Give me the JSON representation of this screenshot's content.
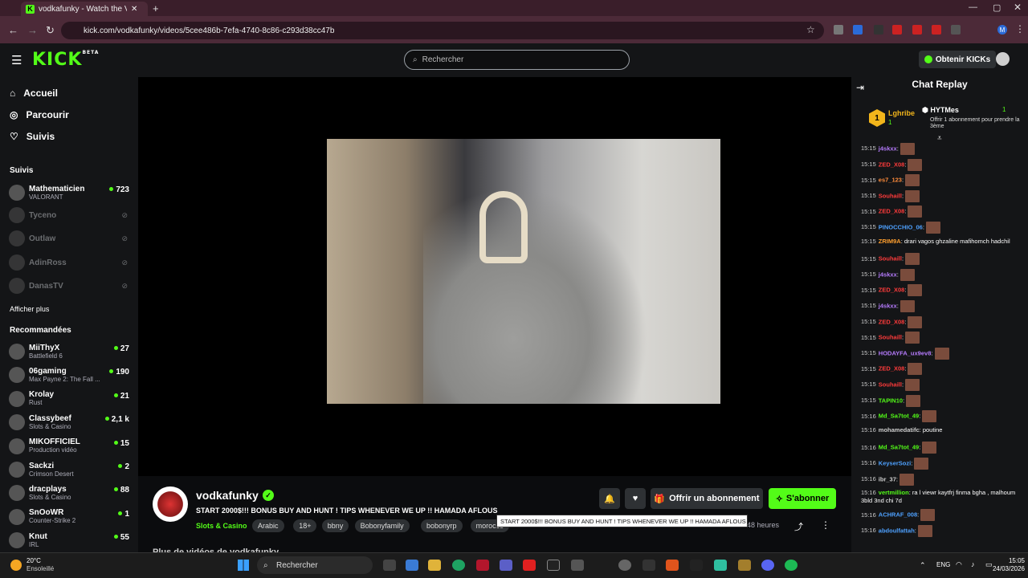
{
  "browser": {
    "tab_title": "vodkafunky - Watch the VO",
    "url": "kick.com/vodkafunky/videos/5cee486b-7efa-4740-8c86-c293d38cc47b"
  },
  "header": {
    "logo": "KICK",
    "logo_badge": "BETA",
    "search_placeholder": "Rechercher",
    "kicks_button": "Obtenir KICKs"
  },
  "sidebar": {
    "nav": [
      {
        "label": "Accueil",
        "icon": "home-icon"
      },
      {
        "label": "Parcourir",
        "icon": "compass-icon"
      },
      {
        "label": "Suivis",
        "icon": "heart-icon"
      }
    ],
    "followed_title": "Suivis",
    "followed": [
      {
        "name": "Mathematicien",
        "sub": "VALORANT",
        "count": "723",
        "live": true
      },
      {
        "name": "Tyceno",
        "sub": "",
        "count": "",
        "live": false
      },
      {
        "name": "Outlaw",
        "sub": "",
        "count": "",
        "live": false
      },
      {
        "name": "AdinRoss",
        "sub": "",
        "count": "",
        "live": false
      },
      {
        "name": "DanasTV",
        "sub": "",
        "count": "",
        "live": false
      }
    ],
    "show_more": "Afficher plus",
    "recommended_title": "Recommandées",
    "recommended": [
      {
        "name": "MiiThyX",
        "sub": "Battlefield 6",
        "count": "27"
      },
      {
        "name": "06gaming",
        "sub": "Max Payne 2: The Fall ...",
        "count": "190"
      },
      {
        "name": "Krolay",
        "sub": "Rust",
        "count": "21"
      },
      {
        "name": "Classybeef",
        "sub": "Slots & Casino",
        "count": "2,1 k"
      },
      {
        "name": "MIKOFFICIEL",
        "sub": "Production vidéo",
        "count": "15"
      },
      {
        "name": "Sackzi",
        "sub": "Crimson Desert",
        "count": "2"
      },
      {
        "name": "dracplays",
        "sub": "Slots & Casino",
        "count": "88"
      },
      {
        "name": "SnOoWR",
        "sub": "Counter-Strike 2",
        "count": "1"
      },
      {
        "name": "Knut",
        "sub": "IRL",
        "count": "55"
      }
    ]
  },
  "video": {
    "channel": "vodkafunky",
    "title": "START 2000$!!! BONUS BUY AND HUNT ! TIPS WHENEVER WE UP !! HAMADA AFLOUS",
    "category": "Slots & Casino",
    "tags": [
      "Arabic",
      "18+",
      "bbny",
      "Bobonyfamily",
      "bobonyrp",
      "morocco"
    ],
    "tooltip": "START 2000$!!! BONUS BUY AND HUNT ! TIPS WHENEVER WE UP !! HAMADA AFLOUS",
    "age": "48 heures",
    "gift_button": "Offrir un abonnement",
    "subscribe_button": "S'abonner",
    "more_videos": "Plus de vidéos de vodkafunky"
  },
  "chat": {
    "title": "Chat Replay",
    "gifter_rank": "1",
    "gifter_name": "Lghribe",
    "gifter_count": "1",
    "recipient_name": "HYTMes",
    "recipient_count": "1",
    "gift_text": "Offrir 1 abonnement pour prendre la 3ème",
    "messages": [
      {
        "t": "15:15",
        "u": "j4skxx",
        "c": "#b77cff",
        "m": "",
        "e": true
      },
      {
        "t": "15:15",
        "u": "ZED_X08",
        "c": "#ff3b3b",
        "m": "",
        "e": true
      },
      {
        "t": "15:15",
        "u": "es7_123",
        "c": "#ff8c3b",
        "m": "",
        "e": true
      },
      {
        "t": "15:15",
        "u": "Souhaill",
        "c": "#ff3b3b",
        "m": "",
        "e": true
      },
      {
        "t": "15:15",
        "u": "ZED_X08",
        "c": "#ff3b3b",
        "m": "",
        "e": true
      },
      {
        "t": "15:15",
        "u": "PINOCCHIO_06",
        "c": "#4ea1ff",
        "m": "",
        "e": true
      },
      {
        "t": "15:15",
        "u": "ZRIM9A",
        "c": "#ff9f2e",
        "m": "drari vagos ghzaline mafihomch hadchil",
        "e": false
      },
      {
        "t": "15:15",
        "u": "Souhaill",
        "c": "#ff3b3b",
        "m": "",
        "e": true
      },
      {
        "t": "15:15",
        "u": "j4skxx",
        "c": "#b77cff",
        "m": "",
        "e": true
      },
      {
        "t": "15:15",
        "u": "ZED_X08",
        "c": "#ff3b3b",
        "m": "",
        "e": true
      },
      {
        "t": "15:15",
        "u": "j4skxx",
        "c": "#b77cff",
        "m": "",
        "e": true
      },
      {
        "t": "15:15",
        "u": "ZED_X08",
        "c": "#ff3b3b",
        "m": "",
        "e": true
      },
      {
        "t": "15:15",
        "u": "Souhaill",
        "c": "#ff3b3b",
        "m": "",
        "e": true
      },
      {
        "t": "15:15",
        "u": "HODAYFA_ux9ev8",
        "c": "#b77cff",
        "m": "",
        "e": true
      },
      {
        "t": "15:15",
        "u": "ZED_X08",
        "c": "#ff3b3b",
        "m": "",
        "e": true
      },
      {
        "t": "15:15",
        "u": "Souhaill",
        "c": "#ff3b3b",
        "m": "",
        "e": true
      },
      {
        "t": "15:15",
        "u": "TAPIN10",
        "c": "#53fc18",
        "m": "",
        "e": true
      },
      {
        "t": "15:16",
        "u": "Md_Sa7tot_49",
        "c": "#53fc18",
        "m": "",
        "e": true
      },
      {
        "t": "15:16",
        "u": "mohamedatifc",
        "c": "#cfcfcf",
        "m": "poutine",
        "e": false
      },
      {
        "t": "15:16",
        "u": "Md_Sa7tot_49",
        "c": "#53fc18",
        "m": "",
        "e": true
      },
      {
        "t": "15:16",
        "u": "KeyserSozi",
        "c": "#4ea1ff",
        "m": "",
        "e": true
      },
      {
        "t": "15:16",
        "u": "ibr_37",
        "c": "#cfcfcf",
        "m": "",
        "e": true
      },
      {
        "t": "15:16",
        "u": "vertmillion",
        "c": "#53fc18",
        "m": "ra l viewr kaytfrj finma bgha , malhoum 3bld 3nd chi 7d",
        "e": false
      },
      {
        "t": "15:16",
        "u": "ACHRAF_008",
        "c": "#4ea1ff",
        "m": "",
        "e": true
      },
      {
        "t": "15:16",
        "u": "abdoulfattah",
        "c": "#4ea1ff",
        "m": "",
        "e": true
      }
    ]
  },
  "taskbar": {
    "weather_temp": "20°C",
    "weather_desc": "Ensoleillé",
    "search": "Rechercher",
    "lang": "ENG",
    "time": "15:05",
    "date": "24/03/2026"
  }
}
